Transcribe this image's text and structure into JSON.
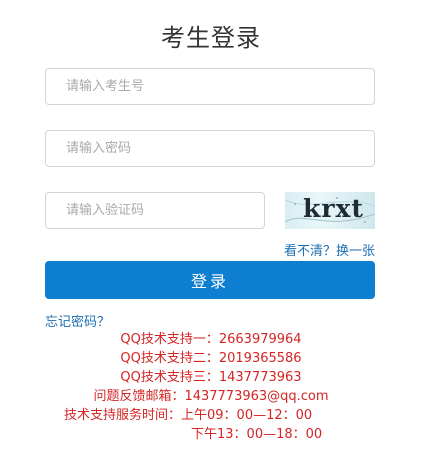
{
  "page": {
    "title": "考生登录"
  },
  "form": {
    "username_placeholder": "请输入考生号",
    "password_placeholder": "请输入密码",
    "captcha_placeholder": "请输入验证码",
    "captcha_image_text": "krxt",
    "refresh_captcha_label": "看不清？换一张",
    "login_button_label": "登录",
    "forgot_password_label": "忘记密码？"
  },
  "support": {
    "qq_support_1": "QQ技术支持一：2663979964",
    "qq_support_2": "QQ技术支持二：2019365586",
    "qq_support_3": "QQ技术支持三：1437773963",
    "feedback_email": "问题反馈邮箱：1437773963@qq.com",
    "service_hours_morning": "技术支持服务时间：上午09：00—12：00",
    "service_hours_afternoon": "下午13：00—18：00"
  },
  "colors": {
    "primary_button": "#0e7fd0",
    "link": "#1f6fb2",
    "support_text": "#d42525",
    "input_border": "#d5d5d5"
  }
}
